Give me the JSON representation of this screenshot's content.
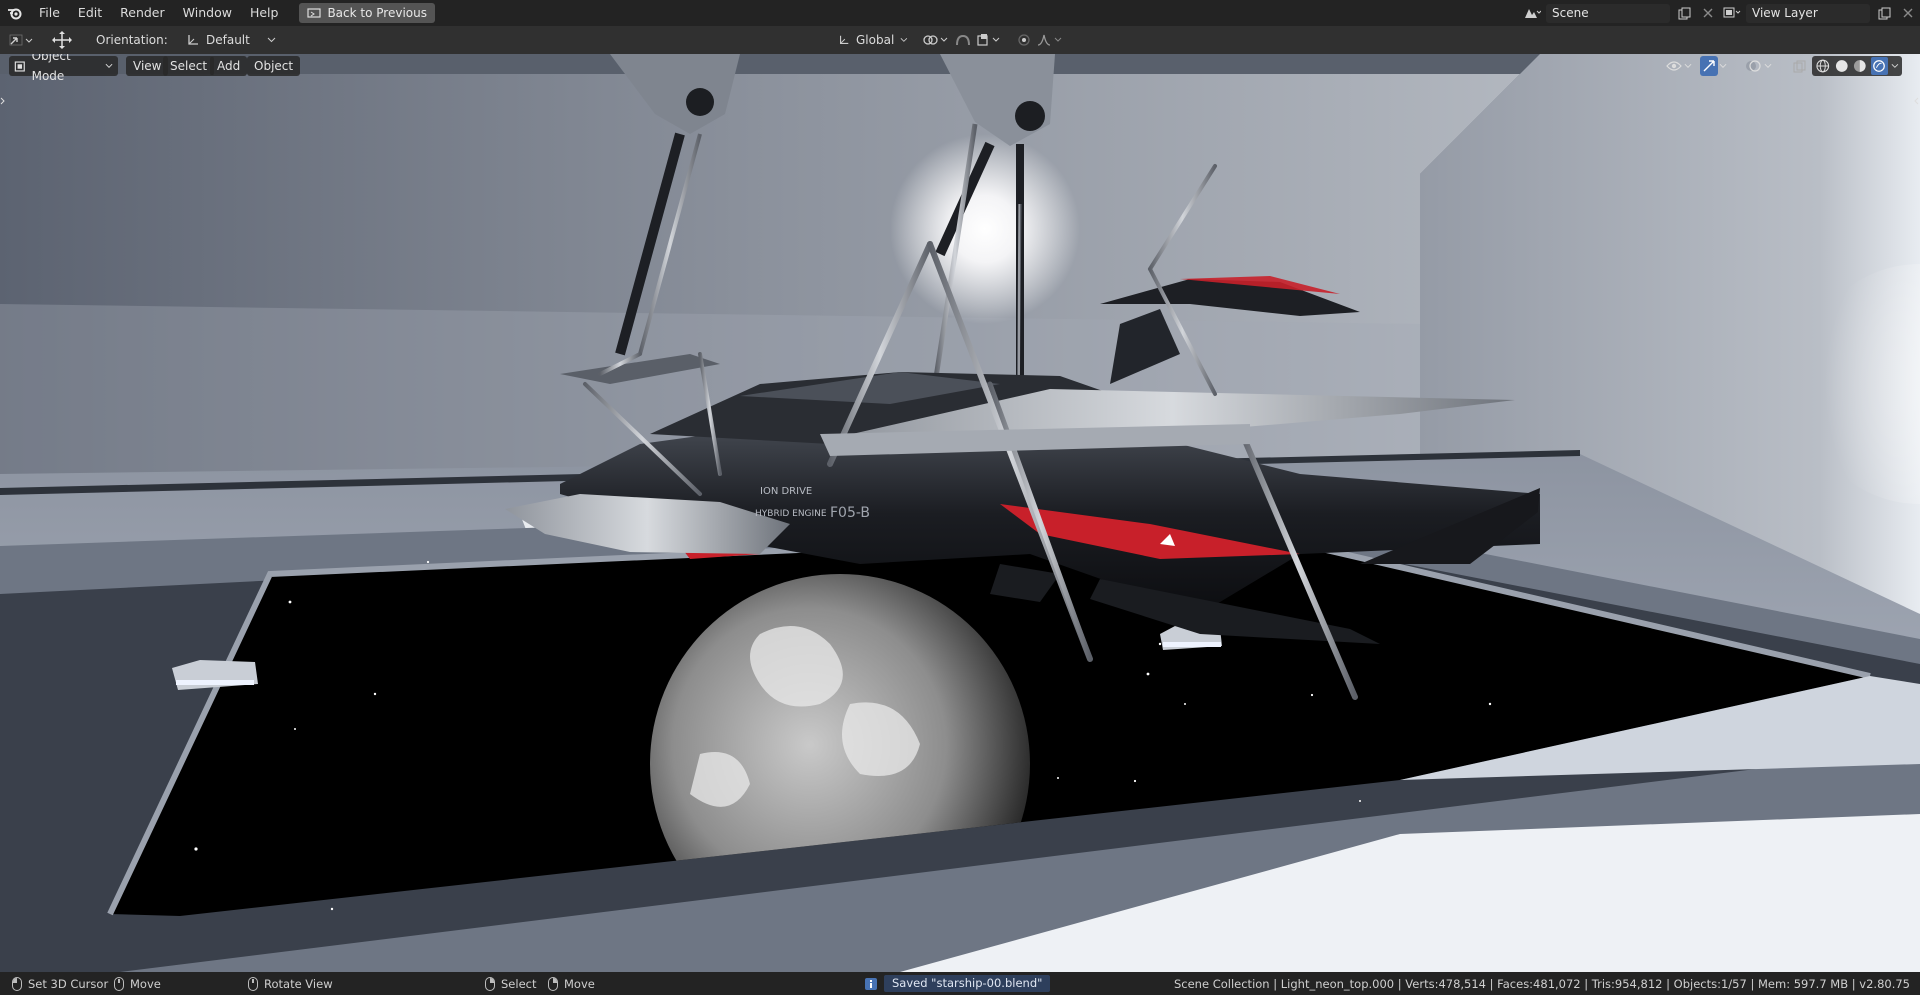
{
  "topbar": {
    "menus": [
      "File",
      "Edit",
      "Render",
      "Window",
      "Help"
    ],
    "back_button": "Back to Previous",
    "scene": "Scene",
    "view_layer": "View Layer"
  },
  "toolbar": {
    "orientation_label": "Orientation:",
    "orientation_value": "Default",
    "transform_orientation": "Global"
  },
  "viewport_header": {
    "mode": "Object Mode",
    "menus": [
      "View",
      "Select",
      "Add",
      "Object"
    ]
  },
  "scene_labels": {
    "engine_text": "HYBRID ENGINE",
    "drive_text": "ION DRIVE",
    "model_text": "F05-B"
  },
  "statusbar": {
    "hint1": "Set 3D Cursor",
    "hint2": "Move",
    "hint3": "Rotate View",
    "hint4": "Select",
    "hint5": "Move",
    "message": "Saved \"starship-00.blend\"",
    "stats": "Scene Collection | Light_neon_top.000 | Verts:478,514 | Faces:481,072 | Tris:954,812 | Objects:1/57 | Mem: 597.7 MB | v2.80.75"
  },
  "colors": {
    "accent_blue": "#4772b3",
    "ship_red": "#c8202a",
    "status_message_bg": "#2e3f5c"
  }
}
